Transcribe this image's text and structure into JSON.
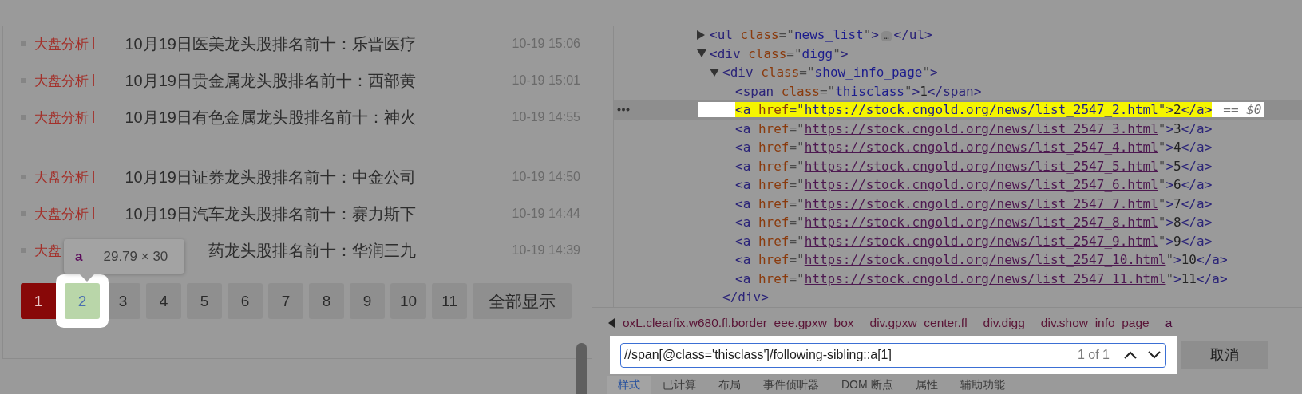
{
  "news_groups": [
    {
      "items": [
        {
          "category": "大盘分析",
          "separator": "|",
          "title": "10月19日医美龙头股排名前十：乐晋医疗",
          "time": "10-19 15:06"
        },
        {
          "category": "大盘分析",
          "separator": "|",
          "title": "10月19日贵金属龙头股排名前十：西部黄",
          "time": "10-19 15:01"
        },
        {
          "category": "大盘分析",
          "separator": "|",
          "title": "10月19日有色金属龙头股排名前十：神火",
          "time": "10-19 14:55"
        }
      ]
    },
    {
      "items": [
        {
          "category": "大盘分析",
          "separator": "|",
          "title": "10月19日证券龙头股排名前十：中金公司",
          "time": "10-19 14:50"
        },
        {
          "category": "大盘分析",
          "separator": "|",
          "title": "10月19日汽车龙头股排名前十：赛力斯下",
          "time": "10-19 14:44"
        },
        {
          "category": "大盘",
          "title": "药龙头股排名前十：华润三九",
          "time": "10-19 14:39"
        }
      ]
    }
  ],
  "pagination": {
    "pages": [
      {
        "label": "1",
        "selected": true,
        "inspected": false
      },
      {
        "label": "2",
        "selected": false,
        "inspected": true
      },
      {
        "label": "3",
        "selected": false,
        "inspected": false
      },
      {
        "label": "4",
        "selected": false,
        "inspected": false
      },
      {
        "label": "5",
        "selected": false,
        "inspected": false
      },
      {
        "label": "6",
        "selected": false,
        "inspected": false
      },
      {
        "label": "7",
        "selected": false,
        "inspected": false
      },
      {
        "label": "8",
        "selected": false,
        "inspected": false
      },
      {
        "label": "9",
        "selected": false,
        "inspected": false
      },
      {
        "label": "10",
        "selected": false,
        "inspected": false
      },
      {
        "label": "11",
        "selected": false,
        "inspected": false
      }
    ],
    "show_all": "全部显示"
  },
  "inspect_tooltip": {
    "tag": "a",
    "size": "29.79 × 30"
  },
  "dom_tree": [
    {
      "expanded": false,
      "selected": false,
      "tokens": [
        {
          "kind": "tag",
          "text": "<ul "
        },
        {
          "kind": "attr",
          "text": "class"
        },
        {
          "kind": "punct",
          "text": "=\""
        },
        {
          "kind": "value",
          "text": "news_list"
        },
        {
          "kind": "punct",
          "text": "\""
        },
        {
          "kind": "tag",
          "text": ">"
        },
        {
          "kind": "badge",
          "text": "…"
        },
        {
          "kind": "tag",
          "text": "</ul>"
        }
      ]
    },
    {
      "expanded": true,
      "selected": false,
      "tokens": [
        {
          "kind": "tag",
          "text": "<div "
        },
        {
          "kind": "attr",
          "text": "class"
        },
        {
          "kind": "punct",
          "text": "=\""
        },
        {
          "kind": "value",
          "text": "digg"
        },
        {
          "kind": "punct",
          "text": "\""
        },
        {
          "kind": "tag",
          "text": ">"
        }
      ],
      "children": [
        {
          "expanded": true,
          "selected": false,
          "tokens": [
            {
              "kind": "tag",
              "text": "<div "
            },
            {
              "kind": "attr",
              "text": "class"
            },
            {
              "kind": "punct",
              "text": "=\""
            },
            {
              "kind": "value",
              "text": "show_info_page"
            },
            {
              "kind": "punct",
              "text": "\""
            },
            {
              "kind": "tag",
              "text": ">"
            }
          ],
          "closing": [
            {
              "kind": "tag",
              "text": "</div>"
            }
          ],
          "children": [
            {
              "selected": false,
              "tokens": [
                {
                  "kind": "tag",
                  "text": "<span "
                },
                {
                  "kind": "attr",
                  "text": "class"
                },
                {
                  "kind": "punct",
                  "text": "=\""
                },
                {
                  "kind": "value",
                  "text": "thisclass"
                },
                {
                  "kind": "punct",
                  "text": "\""
                },
                {
                  "kind": "tag",
                  "text": ">"
                },
                {
                  "kind": "text",
                  "text": "1"
                },
                {
                  "kind": "tag",
                  "text": "</span>"
                }
              ]
            },
            {
              "selected": true,
              "tokens": [
                {
                  "kind": "tag",
                  "text": "<a "
                },
                {
                  "kind": "attr",
                  "text": "href"
                },
                {
                  "kind": "punct",
                  "text": "=\""
                },
                {
                  "kind": "value",
                  "text": "https://stock.cngold.org/news/list_2547_2.html"
                },
                {
                  "kind": "punct",
                  "text": "\""
                },
                {
                  "kind": "tag",
                  "text": ">"
                },
                {
                  "kind": "text",
                  "text": "2"
                },
                {
                  "kind": "tag",
                  "text": "</a>"
                },
                {
                  "kind": "ref",
                  "text": "== $0"
                }
              ]
            },
            {
              "selected": false,
              "tokens": [
                {
                  "kind": "tag",
                  "text": "<a "
                },
                {
                  "kind": "attr",
                  "text": "href"
                },
                {
                  "kind": "punct",
                  "text": "=\""
                },
                {
                  "kind": "link",
                  "text": "https://stock.cngold.org/news/list_2547_3.html"
                },
                {
                  "kind": "punct",
                  "text": "\""
                },
                {
                  "kind": "tag",
                  "text": ">"
                },
                {
                  "kind": "text",
                  "text": "3"
                },
                {
                  "kind": "tag",
                  "text": "</a>"
                }
              ]
            },
            {
              "selected": false,
              "tokens": [
                {
                  "kind": "tag",
                  "text": "<a "
                },
                {
                  "kind": "attr",
                  "text": "href"
                },
                {
                  "kind": "punct",
                  "text": "=\""
                },
                {
                  "kind": "link",
                  "text": "https://stock.cngold.org/news/list_2547_4.html"
                },
                {
                  "kind": "punct",
                  "text": "\""
                },
                {
                  "kind": "tag",
                  "text": ">"
                },
                {
                  "kind": "text",
                  "text": "4"
                },
                {
                  "kind": "tag",
                  "text": "</a>"
                }
              ]
            },
            {
              "selected": false,
              "tokens": [
                {
                  "kind": "tag",
                  "text": "<a "
                },
                {
                  "kind": "attr",
                  "text": "href"
                },
                {
                  "kind": "punct",
                  "text": "=\""
                },
                {
                  "kind": "link",
                  "text": "https://stock.cngold.org/news/list_2547_5.html"
                },
                {
                  "kind": "punct",
                  "text": "\""
                },
                {
                  "kind": "tag",
                  "text": ">"
                },
                {
                  "kind": "text",
                  "text": "5"
                },
                {
                  "kind": "tag",
                  "text": "</a>"
                }
              ]
            },
            {
              "selected": false,
              "tokens": [
                {
                  "kind": "tag",
                  "text": "<a "
                },
                {
                  "kind": "attr",
                  "text": "href"
                },
                {
                  "kind": "punct",
                  "text": "=\""
                },
                {
                  "kind": "link",
                  "text": "https://stock.cngold.org/news/list_2547_6.html"
                },
                {
                  "kind": "punct",
                  "text": "\""
                },
                {
                  "kind": "tag",
                  "text": ">"
                },
                {
                  "kind": "text",
                  "text": "6"
                },
                {
                  "kind": "tag",
                  "text": "</a>"
                }
              ]
            },
            {
              "selected": false,
              "tokens": [
                {
                  "kind": "tag",
                  "text": "<a "
                },
                {
                  "kind": "attr",
                  "text": "href"
                },
                {
                  "kind": "punct",
                  "text": "=\""
                },
                {
                  "kind": "link",
                  "text": "https://stock.cngold.org/news/list_2547_7.html"
                },
                {
                  "kind": "punct",
                  "text": "\""
                },
                {
                  "kind": "tag",
                  "text": ">"
                },
                {
                  "kind": "text",
                  "text": "7"
                },
                {
                  "kind": "tag",
                  "text": "</a>"
                }
              ]
            },
            {
              "selected": false,
              "tokens": [
                {
                  "kind": "tag",
                  "text": "<a "
                },
                {
                  "kind": "attr",
                  "text": "href"
                },
                {
                  "kind": "punct",
                  "text": "=\""
                },
                {
                  "kind": "link",
                  "text": "https://stock.cngold.org/news/list_2547_8.html"
                },
                {
                  "kind": "punct",
                  "text": "\""
                },
                {
                  "kind": "tag",
                  "text": ">"
                },
                {
                  "kind": "text",
                  "text": "8"
                },
                {
                  "kind": "tag",
                  "text": "</a>"
                }
              ]
            },
            {
              "selected": false,
              "tokens": [
                {
                  "kind": "tag",
                  "text": "<a "
                },
                {
                  "kind": "attr",
                  "text": "href"
                },
                {
                  "kind": "punct",
                  "text": "=\""
                },
                {
                  "kind": "link",
                  "text": "https://stock.cngold.org/news/list_2547_9.html"
                },
                {
                  "kind": "punct",
                  "text": "\""
                },
                {
                  "kind": "tag",
                  "text": ">"
                },
                {
                  "kind": "text",
                  "text": "9"
                },
                {
                  "kind": "tag",
                  "text": "</a>"
                }
              ]
            },
            {
              "selected": false,
              "tokens": [
                {
                  "kind": "tag",
                  "text": "<a "
                },
                {
                  "kind": "attr",
                  "text": "href"
                },
                {
                  "kind": "punct",
                  "text": "=\""
                },
                {
                  "kind": "link",
                  "text": "https://stock.cngold.org/news/list_2547_10.html"
                },
                {
                  "kind": "punct",
                  "text": "\""
                },
                {
                  "kind": "tag",
                  "text": ">"
                },
                {
                  "kind": "text",
                  "text": "10"
                },
                {
                  "kind": "tag",
                  "text": "</a>"
                }
              ]
            },
            {
              "selected": false,
              "tokens": [
                {
                  "kind": "tag",
                  "text": "<a "
                },
                {
                  "kind": "attr",
                  "text": "href"
                },
                {
                  "kind": "punct",
                  "text": "=\""
                },
                {
                  "kind": "link",
                  "text": "https://stock.cngold.org/news/list_2547_11.html"
                },
                {
                  "kind": "punct",
                  "text": "\""
                },
                {
                  "kind": "tag",
                  "text": ">"
                },
                {
                  "kind": "text",
                  "text": "11"
                },
                {
                  "kind": "tag",
                  "text": "</a>"
                }
              ]
            }
          ]
        }
      ]
    }
  ],
  "breadcrumbs": [
    {
      "label": "oxL.clearfix.w680.fl.border_eee.gpxw_box",
      "selected": false
    },
    {
      "label": "div.gpxw_center.fl",
      "selected": false
    },
    {
      "label": "div.digg",
      "selected": false
    },
    {
      "label": "div.show_info_page",
      "selected": false
    },
    {
      "label": "a",
      "selected": true
    }
  ],
  "search": {
    "value": "//span[@class='thisclass']/following-sibling::a[1]",
    "count": "1 of 1",
    "cancel": "取消"
  },
  "panel_tabs": [
    {
      "label": "样式",
      "selected": true
    },
    {
      "label": "已计算",
      "selected": false
    },
    {
      "label": "布局",
      "selected": false
    },
    {
      "label": "事件侦听器",
      "selected": false
    },
    {
      "label": "DOM 断点",
      "selected": false
    },
    {
      "label": "属性",
      "selected": false
    },
    {
      "label": "辅助功能",
      "selected": false
    }
  ]
}
